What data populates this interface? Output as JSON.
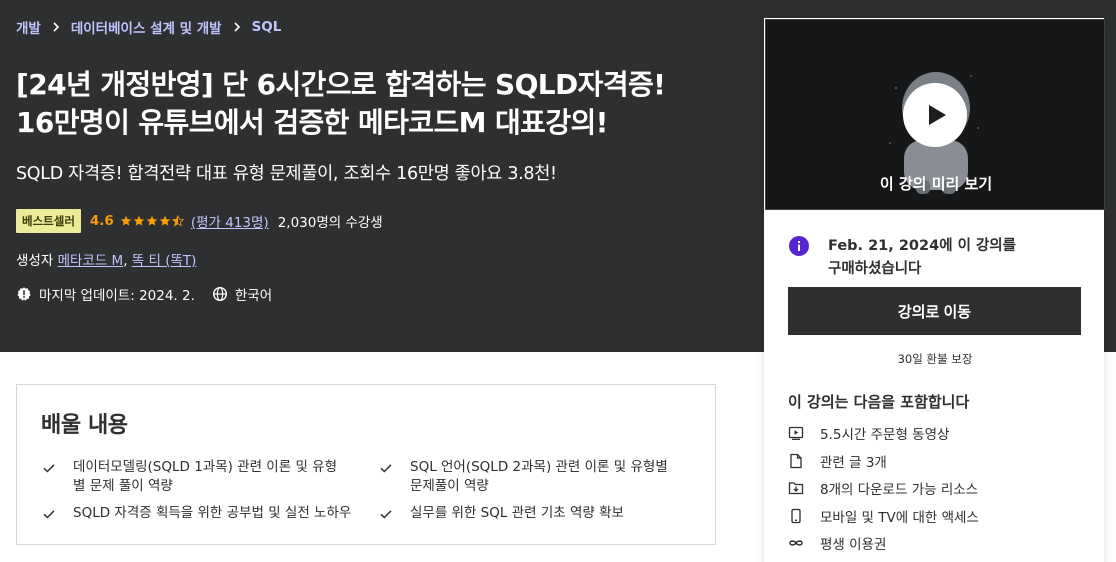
{
  "breadcrumb": [
    "개발",
    "데이터베이스 설계 및 개발",
    "SQL"
  ],
  "course": {
    "title_line1": "[24년 개정반영] 단 6시간으로 합격하는 SQLD자격증!",
    "title_line2": "16만명이 유튜브에서 검증한 메타코드M 대표강의!",
    "subtitle": "SQLD 자격증! 합격전략 대표 유형 문제풀이, 조회수 16만명 좋아요 3.8천!",
    "badge": "베스트셀러",
    "rating": "4.6",
    "rating_stars": 4.6,
    "rating_count": "(평가 413명)",
    "students": "2,030명의 수강생",
    "created_by_label": "생성자",
    "creators": [
      "메타코드 M",
      "똑 티 (똑T)"
    ],
    "creator_sep": ",",
    "last_updated": "마지막 업데이트: 2024. 2.",
    "language": "한국어"
  },
  "learn": {
    "title": "배울 내용",
    "items": [
      "데이터모델링(SQLD 1과목) 관련 이론 및 유형별 문제 풀이 역량",
      "SQL 언어(SQLD 2과목) 관련 이론 및 유형별 문제풀이 역량",
      "SQLD 자격증 획득을 위한 공부법 및 실전 노하우",
      "실무를 위한 SQL 관련 기초 역량 확보"
    ]
  },
  "sidebar": {
    "preview_label": "이 강의 미리 보기",
    "purchase_date": "Feb. 21, 2024",
    "purchase_suffix": "에 이 강의를",
    "purchase_line2": "구매하셨습니다",
    "go_button": "강의로 이동",
    "guarantee": "30일 환불 보장",
    "includes_title": "이 강의는 다음을 포함합니다",
    "includes": [
      {
        "icon": "video-icon",
        "text": "5.5시간 주문형 동영상"
      },
      {
        "icon": "file-icon",
        "text": "관련 글 3개"
      },
      {
        "icon": "folder-download-icon",
        "text": "8개의 다운로드 가능 리소스"
      },
      {
        "icon": "mobile-icon",
        "text": "모바일 및 TV에 대한 액세스"
      },
      {
        "icon": "infinity-icon",
        "text": "평생 이용권"
      }
    ]
  },
  "colors": {
    "hero_bg": "#2d2f31",
    "link": "#c0c4fc",
    "rating": "#f69c08",
    "badge_bg": "#eceb98",
    "info_purple": "#5624d0"
  }
}
